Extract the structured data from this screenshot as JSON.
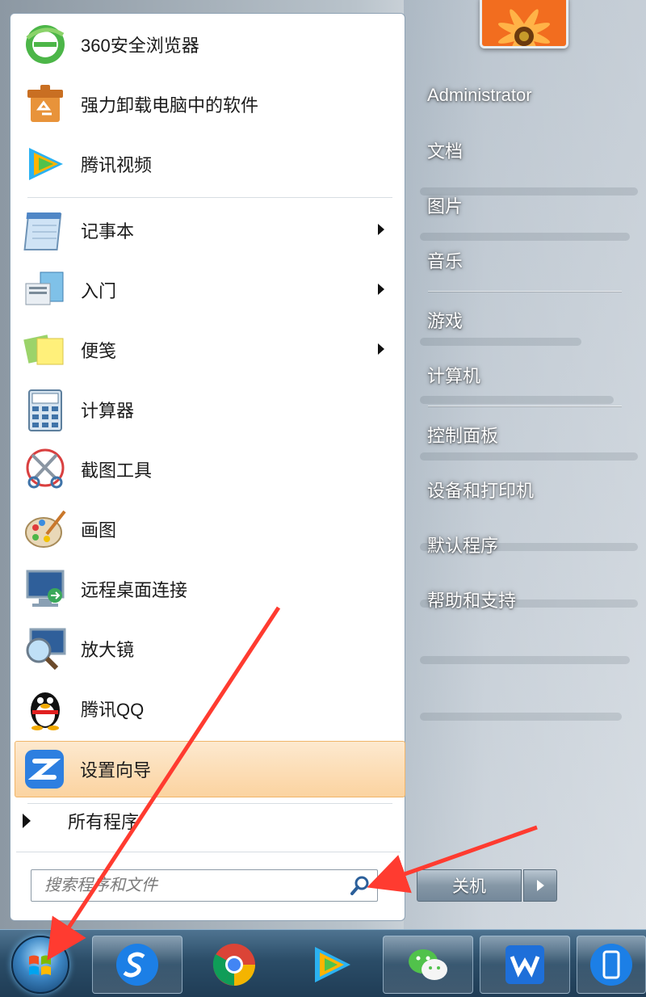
{
  "start_menu": {
    "pinned": [
      {
        "label": "360安全浏览器",
        "icon": "360-browser-icon"
      },
      {
        "label": "强力卸载电脑中的软件",
        "icon": "uninstall-box-icon"
      },
      {
        "label": "腾讯视频",
        "icon": "tencent-video-icon"
      }
    ],
    "recent": [
      {
        "label": "记事本",
        "icon": "notepad-icon",
        "submenu": true
      },
      {
        "label": "入门",
        "icon": "getting-started-icon",
        "submenu": true
      },
      {
        "label": "便笺",
        "icon": "sticky-notes-icon",
        "submenu": true
      },
      {
        "label": "计算器",
        "icon": "calculator-icon",
        "submenu": false
      },
      {
        "label": "截图工具",
        "icon": "snipping-tool-icon",
        "submenu": false
      },
      {
        "label": "画图",
        "icon": "paint-icon",
        "submenu": false
      },
      {
        "label": "远程桌面连接",
        "icon": "remote-desktop-icon",
        "submenu": false
      },
      {
        "label": "放大镜",
        "icon": "magnifier-icon",
        "submenu": false
      },
      {
        "label": "腾讯QQ",
        "icon": "qq-penguin-icon",
        "submenu": false
      },
      {
        "label": "设置向导",
        "icon": "setup-wizard-icon",
        "submenu": false,
        "highlighted": true
      }
    ],
    "all_programs": "所有程序",
    "search_placeholder": "搜索程序和文件"
  },
  "right_pane": {
    "user_name": "Administrator",
    "group1": [
      "文档",
      "图片",
      "音乐"
    ],
    "group2": [
      "游戏",
      "计算机"
    ],
    "group3": [
      "控制面板",
      "设备和打印机",
      "默认程序",
      "帮助和支持"
    ],
    "shutdown_label": "关机"
  },
  "taskbar": {
    "buttons": [
      "sogou-browser-icon",
      "chrome-icon",
      "tencent-video-icon",
      "wechat-icon",
      "wps-icon",
      "phone-icon"
    ]
  },
  "colors": {
    "highlight_bg": "#fbd3a0",
    "annotation_arrow": "#ff3b30"
  }
}
